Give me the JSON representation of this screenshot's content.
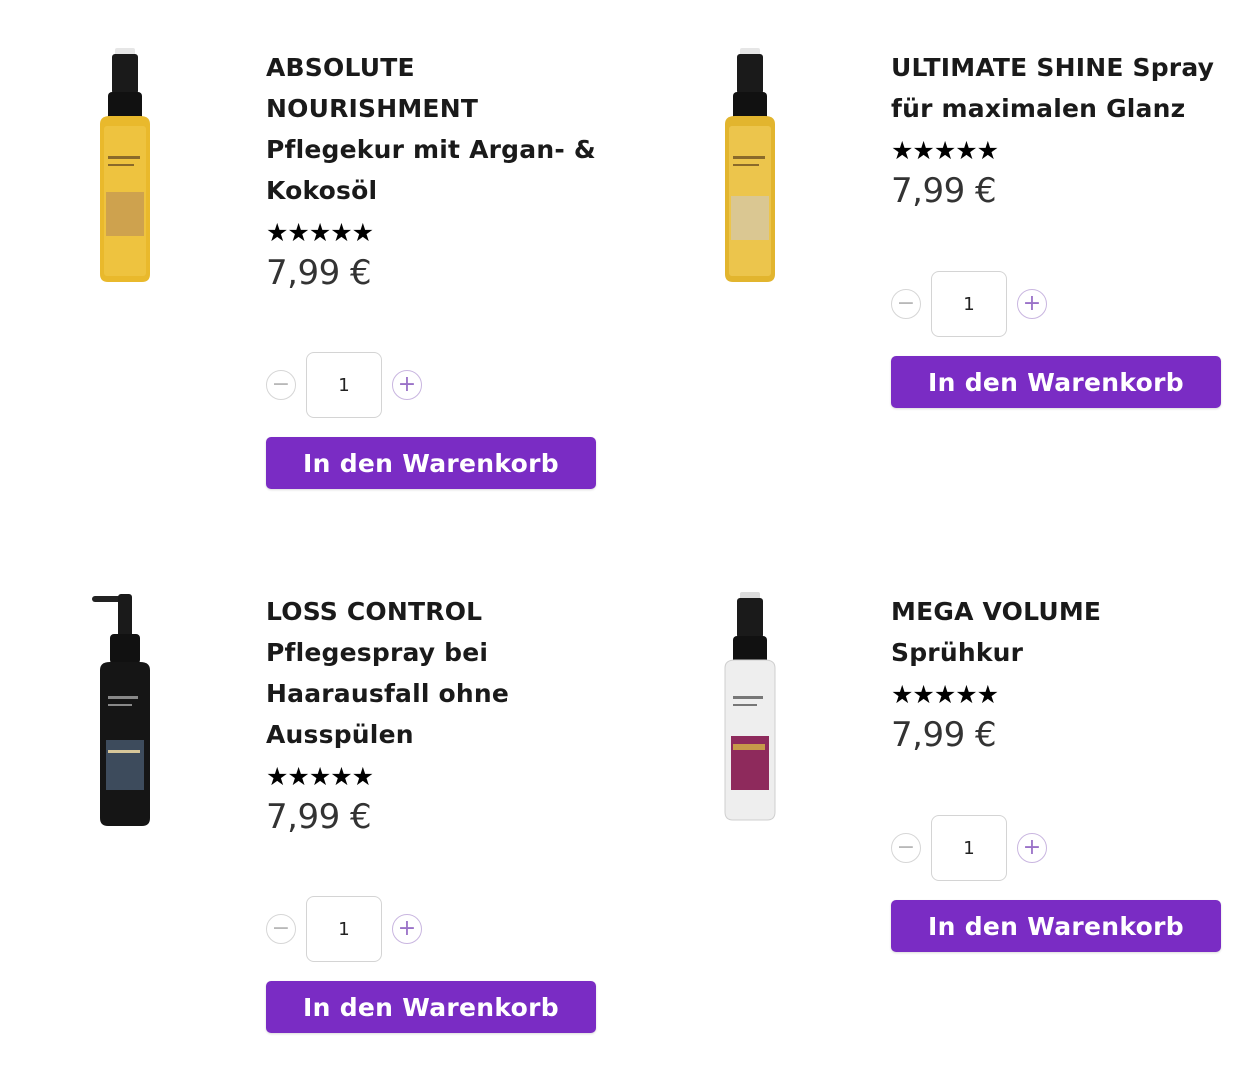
{
  "products": [
    {
      "title_lines": [
        "ABSOLUTE",
        "NOURISHMENT",
        "Pflegekur mit Argan- &",
        "Kokosöl"
      ],
      "stars": "★★★★★",
      "price": "7,99 €",
      "quantity": "1",
      "cart_label": "In den Warenkorb",
      "image_icon": "gold-spray-bottle-icon"
    },
    {
      "title_lines": [
        "ULTIMATE SHINE Spray",
        "für maximalen Glanz"
      ],
      "stars": "★★★★★",
      "price": "7,99 €",
      "quantity": "1",
      "cart_label": "In den Warenkorb",
      "image_icon": "gold-spray-bottle-icon"
    },
    {
      "title_lines": [
        "LOSS CONTROL",
        "Pflegespray bei",
        "Haarausfall ohne",
        "Ausspülen"
      ],
      "stars": "★★★★★",
      "price": "7,99 €",
      "quantity": "1",
      "cart_label": "In den Warenkorb",
      "image_icon": "black-pump-bottle-icon"
    },
    {
      "title_lines": [
        "MEGA VOLUME",
        "Sprühkur"
      ],
      "stars": "★★★★★",
      "price": "7,99 €",
      "quantity": "1",
      "cart_label": "In den Warenkorb",
      "image_icon": "clear-spray-bottle-icon"
    }
  ],
  "quantity_controls": {
    "minus_symbol": "−",
    "plus_symbol": "+"
  },
  "colors": {
    "cart_button": "#7a2cc4",
    "plus_accent": "#9a72c8"
  }
}
